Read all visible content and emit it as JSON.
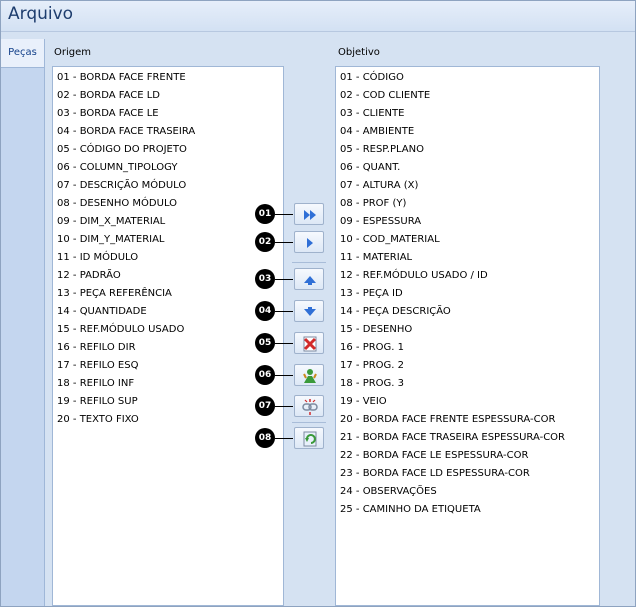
{
  "window": {
    "title": "Arquivo"
  },
  "tabs": [
    {
      "label": "Peças"
    }
  ],
  "origem": {
    "label": "Origem",
    "items": [
      "01 - BORDA FACE FRENTE",
      "02 - BORDA FACE LD",
      "03 - BORDA FACE LE",
      "04 - BORDA FACE TRASEIRA",
      "05 - CÓDIGO DO PROJETO",
      "06 - COLUMN_TIPOLOGY",
      "07 - DESCRIÇÃO MÓDULO",
      "08 - DESENHO MÓDULO",
      "09 - DIM_X_MATERIAL",
      "10 - DIM_Y_MATERIAL",
      "11 - ID MÓDULO",
      "12 - PADRÃO",
      "13 - PEÇA REFERÊNCIA",
      "14 - QUANTIDADE",
      "15 - REF.MÓDULO USADO",
      "16 - REFILO DIR",
      "17 - REFILO ESQ",
      "18 - REFILO INF",
      "19 - REFILO SUP",
      "20 - TEXTO FIXO"
    ]
  },
  "objetivo": {
    "label": "Objetivo",
    "items": [
      "01 - CÓDIGO",
      "02 - COD CLIENTE",
      "03 - CLIENTE",
      "04 - AMBIENTE",
      "05 - RESP.PLANO",
      "06 - QUANT.",
      "07 - ALTURA (X)",
      "08 - PROF (Y)",
      "09 - ESPESSURA",
      "10 - COD_MATERIAL",
      "11 - MATERIAL",
      "12 - REF.MÓDULO USADO / ID",
      "13 - PEÇA ID",
      "14 - PEÇA DESCRIÇÃO",
      "15 - DESENHO",
      "16 - PROG. 1",
      "17 - PROG. 2",
      "18 - PROG. 3",
      "19 - VEIO",
      "20 - BORDA FACE FRENTE ESPESSURA-COR",
      "21 - BORDA FACE TRASEIRA ESPESSURA-COR",
      "22 - BORDA FACE LE ESPESSURA-COR",
      "23 - BORDA FACE LD ESPESSURA-COR",
      "24 - OBSERVAÇÕES",
      "25 - CAMINHO DA ETIQUETA"
    ]
  },
  "buttons": [
    {
      "badge": "01",
      "icon": "double-arrow-right-icon"
    },
    {
      "badge": "02",
      "icon": "arrow-right-icon"
    },
    {
      "badge": "03",
      "icon": "arrow-up-icon"
    },
    {
      "badge": "04",
      "icon": "arrow-down-icon"
    },
    {
      "badge": "05",
      "icon": "delete-icon"
    },
    {
      "badge": "06",
      "icon": "add-person-icon"
    },
    {
      "badge": "07",
      "icon": "link-icon"
    },
    {
      "badge": "08",
      "icon": "refresh-icon"
    }
  ],
  "colors": {
    "accent": "#2f6fd6",
    "title_text": "#1e3d6e",
    "delete_red": "#d22a2a",
    "green": "#3a9a3a"
  }
}
